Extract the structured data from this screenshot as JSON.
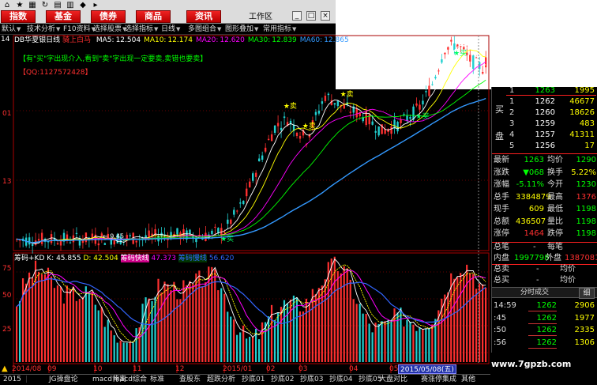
{
  "toolbar": {
    "buttons": [
      "指数",
      "基金",
      "债券",
      "商品",
      "资讯"
    ],
    "workspace": "工作区",
    "icons": [
      "home-icon",
      "star-icon",
      "grid-icon",
      "refresh-icon",
      "book-icon",
      "chart-icon",
      "bookmark-icon",
      "arrow-icon"
    ]
  },
  "menu": {
    "items": [
      "默认",
      "技术分析",
      "F10资料",
      "选择股票",
      "选择指标",
      "日线",
      "多图组合",
      "图形叠加",
      "常用指标"
    ]
  },
  "main_chart": {
    "stock": "DB华夏银日线",
    "pattern": "骑上白马",
    "ma": [
      {
        "label": "MA5:",
        "value": "12.504",
        "color": "#ffffff"
      },
      {
        "label": "MA10:",
        "value": "12.174",
        "color": "#ffff00"
      },
      {
        "label": "MA20:",
        "value": "12.620",
        "color": "#ff00ff"
      },
      {
        "label": "MA30:",
        "value": "12.839",
        "color": "#00ff00"
      },
      {
        "label": "MA60:",
        "value": "12.865",
        "color": "#3399ff"
      }
    ],
    "note": "【有\"买\"字出现介入,看到\"卖\"字出现一定要卖,卖错也要卖】",
    "qq": "【QQ:1127572428】",
    "y_labels": [
      "14",
      "01",
      "13"
    ],
    "low_price": "9.45",
    "buy_label": "买",
    "sell_label": "卖",
    "ylim": [
      9.2,
      14.6
    ]
  },
  "indicator": {
    "title": "筹码+KD",
    "k_label": "K:",
    "k_value": "45.855",
    "d_label": "D:",
    "d_value": "42.504",
    "line1": "筹码快线",
    "line1_value": "47.373",
    "line2": "筹码慢线",
    "line2_value": "56.620",
    "y_labels": [
      "75",
      "50",
      "25"
    ],
    "ylim": [
      0,
      100
    ]
  },
  "timeline": {
    "labels": [
      "2014/08",
      "09",
      "10",
      "11",
      "12",
      "2015/01",
      "02",
      "03",
      "04",
      "05"
    ],
    "date_marker": "2015/05/08(五)"
  },
  "bottom_tabs": [
    "2015",
    "JG操盘论",
    "macd背离",
    "macd综合",
    "标准",
    "查股东",
    "超跌分析",
    "抄底01",
    "抄底02",
    "抄底03",
    "抄底04",
    "抄底05",
    "大盘对比",
    "赛涨停集成",
    "其他"
  ],
  "quote": {
    "ask_label": "卖",
    "bid_label": "买",
    "pan_label": "盘",
    "asks": [
      {
        "level": "1",
        "price": "1263",
        "vol": "1995"
      }
    ],
    "bids": [
      {
        "level": "1",
        "price": "1262",
        "vol": "46677"
      },
      {
        "level": "2",
        "price": "1260",
        "vol": "18626"
      },
      {
        "level": "3",
        "price": "1259",
        "vol": "483"
      },
      {
        "level": "4",
        "price": "1257",
        "vol": "41311"
      },
      {
        "level": "5",
        "price": "1256",
        "vol": "17"
      }
    ],
    "stats": [
      [
        "最新",
        "1263",
        "均价",
        "1290"
      ],
      [
        "涨跌",
        "▼068",
        "换手",
        "5.22%"
      ],
      [
        "涨幅",
        "-5.11%",
        "今开",
        "1230"
      ],
      [
        "总手",
        "3384879",
        "最高",
        "1376"
      ],
      [
        "现手",
        "609",
        "最低",
        "1198"
      ],
      [
        "总额",
        "436507",
        "量比",
        "1198"
      ],
      [
        "涨停",
        "1464",
        "跌停",
        "1198"
      ]
    ],
    "sum_line": [
      "总笔",
      "-",
      "每笔"
    ],
    "inner": [
      "内盘",
      "1997798",
      "外盘",
      "1387081"
    ],
    "total_sell": [
      "总卖",
      "-",
      "均价"
    ],
    "total_buy": [
      "总买",
      "-",
      "均价"
    ],
    "tick_title": "分时成交",
    "tick_tab": "细",
    "ticks": [
      {
        "time": "14:59",
        "price": "1262",
        "vol": "2906"
      },
      {
        "time": ":45",
        "price": "1262",
        "vol": "1977"
      },
      {
        "time": ":50",
        "price": "1262",
        "vol": "2335"
      },
      {
        "time": ":56",
        "price": "1262",
        "vol": "1306"
      }
    ]
  },
  "watermark": "www.7gpzb.com",
  "colors": {
    "up": "#ff3030",
    "down": "#22d0d0",
    "ma60": "#3366ff",
    "accent": "#ff0000"
  }
}
